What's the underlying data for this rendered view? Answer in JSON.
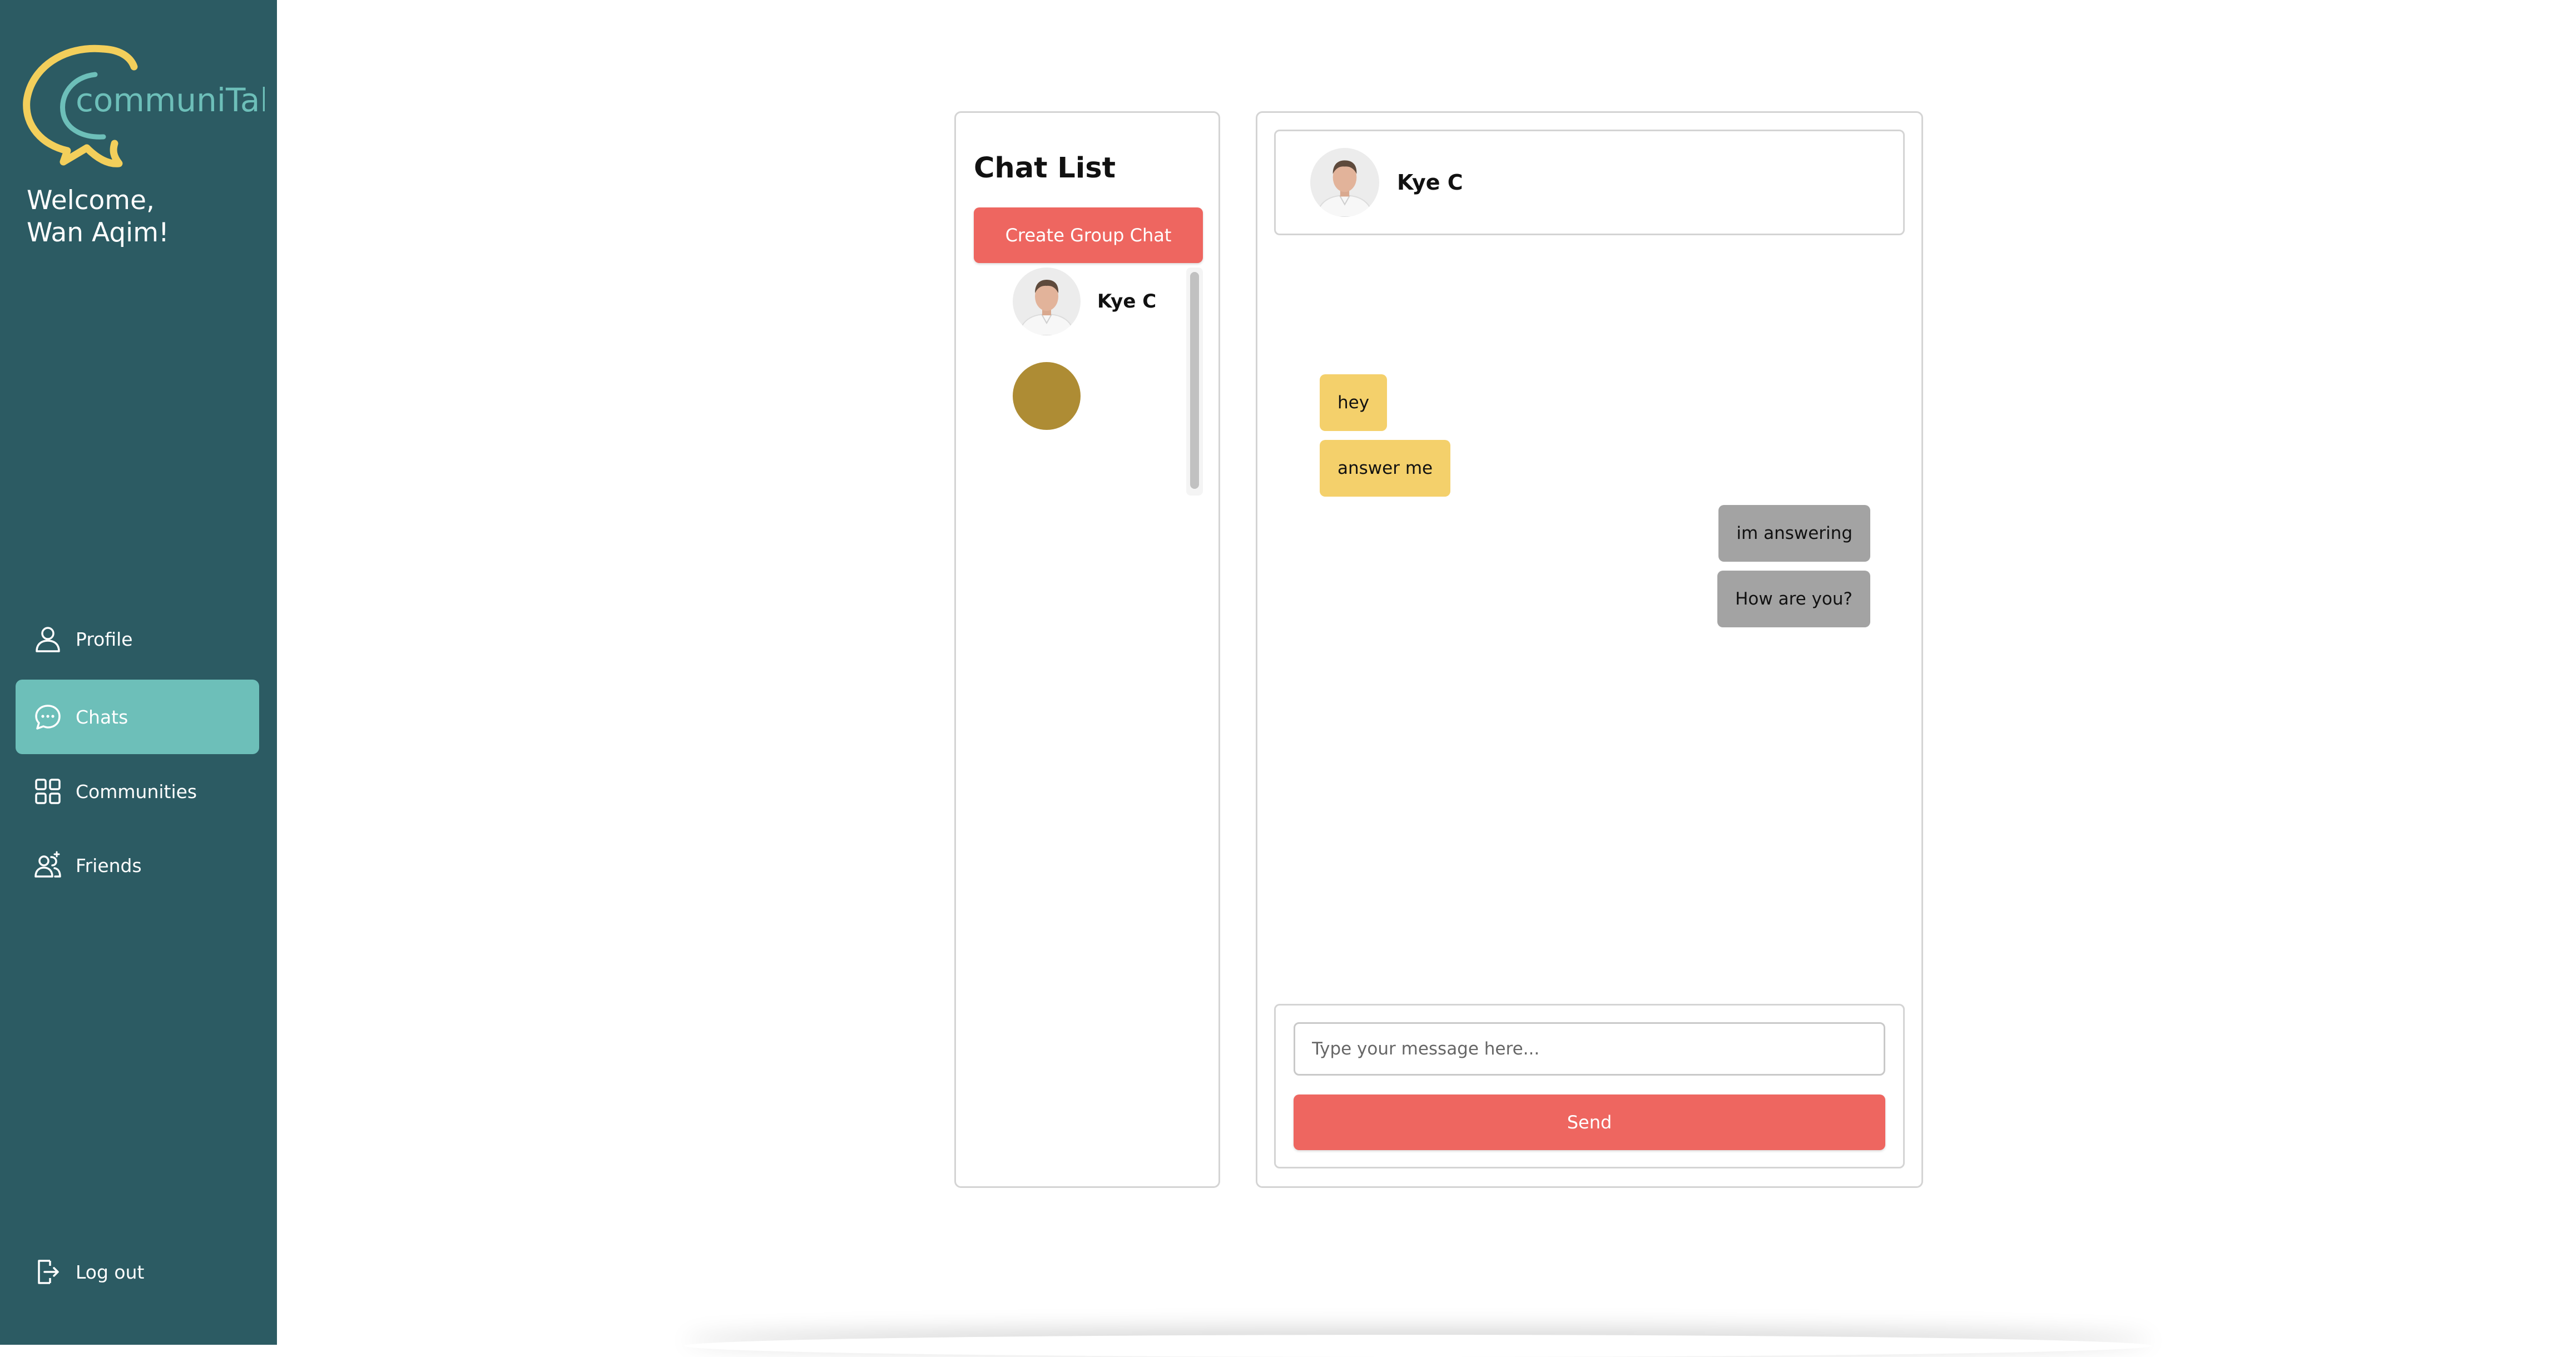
{
  "app": {
    "brand_name": "communiTalk",
    "colors": {
      "sidebar": "#2c5b63",
      "sidebar_active": "#6dbfb9",
      "logo_yellow": "#f3cf5b",
      "logo_teal": "#6dbfb9",
      "accent_red": "#ee6660",
      "bubble_received": "#f4d06b",
      "bubble_sent": "#a3a3a3"
    }
  },
  "sidebar": {
    "welcome_line1": "Welcome,",
    "welcome_line2": "Wan Aqim!",
    "nav": [
      {
        "label": "Profile",
        "icon": "user-icon",
        "active": false
      },
      {
        "label": "Chats",
        "icon": "chat-bubble-icon",
        "active": true
      },
      {
        "label": "Communities",
        "icon": "grid-icon",
        "active": false
      },
      {
        "label": "Friends",
        "icon": "friends-icon",
        "active": false
      }
    ],
    "logout_label": "Log out"
  },
  "chat_list": {
    "title": "Chat List",
    "create_group_label": "Create Group Chat",
    "items": [
      {
        "name": "Kye C",
        "avatar": "photo"
      },
      {
        "name": "",
        "avatar": "placeholder-olive"
      }
    ]
  },
  "chat": {
    "contact_name": "Kye C",
    "messages": [
      {
        "text": "hey",
        "direction": "received"
      },
      {
        "text": "answer me",
        "direction": "received"
      },
      {
        "text": "im answering",
        "direction": "sent"
      },
      {
        "text": "How are you?",
        "direction": "sent"
      }
    ],
    "input_value": "",
    "input_placeholder": "Type your message here...",
    "send_label": "Send"
  }
}
